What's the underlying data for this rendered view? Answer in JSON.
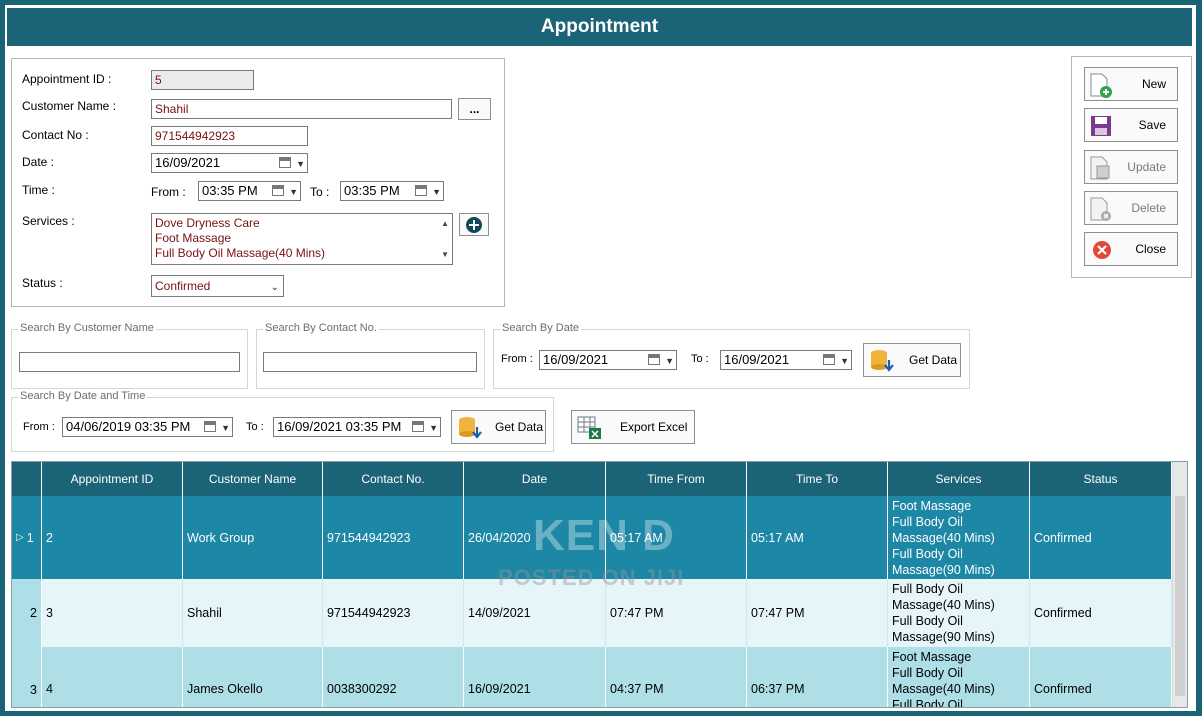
{
  "window": {
    "title": "Appointment"
  },
  "form": {
    "appointment_id_label": "Appointment ID :",
    "appointment_id_value": "5",
    "customer_name_label": "Customer Name :",
    "customer_name_value": "Shahil",
    "browse_label": "...",
    "contact_no_label": "Contact No :",
    "contact_no_value": "971544942923",
    "date_label": "Date :",
    "date_value": "16/09/2021",
    "time_label": "Time :",
    "from_label": "From :",
    "from_value": "03:35 PM",
    "to_label": "To :",
    "to_value": "03:35 PM",
    "services_label": "Services :",
    "services": [
      "Dove Dryness Care",
      "Foot Massage",
      "Full Body Oil Massage(40 Mins)"
    ],
    "status_label": "Status :",
    "status_value": "Confirmed"
  },
  "actions": {
    "new": "New",
    "save": "Save",
    "update": "Update",
    "delete": "Delete",
    "close": "Close"
  },
  "search": {
    "by_customer_caption": "Search By Customer Name",
    "by_contact_caption": "Search By Contact No.",
    "by_date_caption": "Search By Date",
    "by_date_from_label": "From :",
    "by_date_from": "16/09/2021",
    "by_date_to_label": "To :",
    "by_date_to": "16/09/2021",
    "get_data": "Get Data",
    "by_datetime_caption": "Search By Date and Time",
    "by_datetime_from_label": "From :",
    "by_datetime_from": "04/06/2019 03:35 PM",
    "by_datetime_to_label": "To :",
    "by_datetime_to": "16/09/2021 03:35 PM",
    "export_excel": "Export Excel"
  },
  "grid": {
    "columns": [
      "Appointment ID",
      "Customer Name",
      "Contact No.",
      "Date",
      "Time From",
      "Time To",
      "Services",
      "Status"
    ],
    "rows": [
      {
        "num": "1",
        "id": "2",
        "name": "Work Group",
        "contact": "971544942923",
        "date": "26/04/2020",
        "from": "05:17 AM",
        "to": "05:17 AM",
        "services": [
          "Foot Massage",
          "Full Body Oil",
          "Massage(40 Mins)",
          "Full Body Oil",
          "Massage(90 Mins)"
        ],
        "status": "Confirmed"
      },
      {
        "num": "2",
        "id": "3",
        "name": "Shahil",
        "contact": "971544942923",
        "date": "14/09/2021",
        "from": "07:47 PM",
        "to": "07:47 PM",
        "services": [
          "Full Body Oil",
          "Massage(40 Mins)",
          "Full Body Oil",
          "Massage(90 Mins)"
        ],
        "status": "Confirmed"
      },
      {
        "num": "3",
        "id": "4",
        "name": "James Okello",
        "contact": "0038300292",
        "date": "16/09/2021",
        "from": "04:37 PM",
        "to": "06:37 PM",
        "services": [
          "Foot Massage",
          "Full Body Oil",
          "Massage(40 Mins)",
          "Full Body Oil"
        ],
        "status": "Confirmed"
      }
    ]
  },
  "watermark": {
    "line1": "KEN D",
    "line2": "POSTED ON JIJI"
  },
  "colors": {
    "header": "#1b6478",
    "selected_row": "#1d87a6",
    "alt_row": "#e6f5f8",
    "row": "#aedfe6",
    "text_red": "#7a1010"
  }
}
